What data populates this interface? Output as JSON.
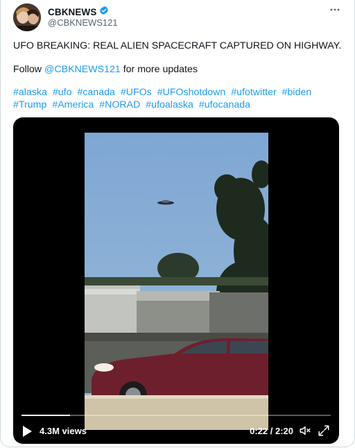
{
  "tweet": {
    "author_name": "CBKNEWS",
    "author_handle": "@CBKNEWS121",
    "more_icon": "more-horizontal-icon",
    "text_line1": "UFO BREAKING: REAL ALIEN SPACECRAFT CAPTURED ON HIGHWAY.",
    "follow_prefix": "Follow ",
    "follow_mention": "@CBKNEWS121",
    "follow_suffix": " for more updates",
    "hashtags": [
      "#alaska",
      "#ufo",
      "#canada",
      "#UFOs",
      "#UFOshotdown",
      "#ufotwitter",
      "#biden",
      "#Trump",
      "#America",
      "#NORAD",
      "#ufoalaska",
      "#ufocanada"
    ]
  },
  "video": {
    "views": "4.3M views",
    "time": "0:22 / 2:20",
    "progress": 0.157,
    "icons": [
      "play-icon",
      "volume-icon",
      "fullscreen-icon"
    ]
  },
  "colors": {
    "link": "#1d9bf0",
    "verified": "#1d9bf0",
    "text": "#0f1419",
    "secondary": "#536471"
  }
}
